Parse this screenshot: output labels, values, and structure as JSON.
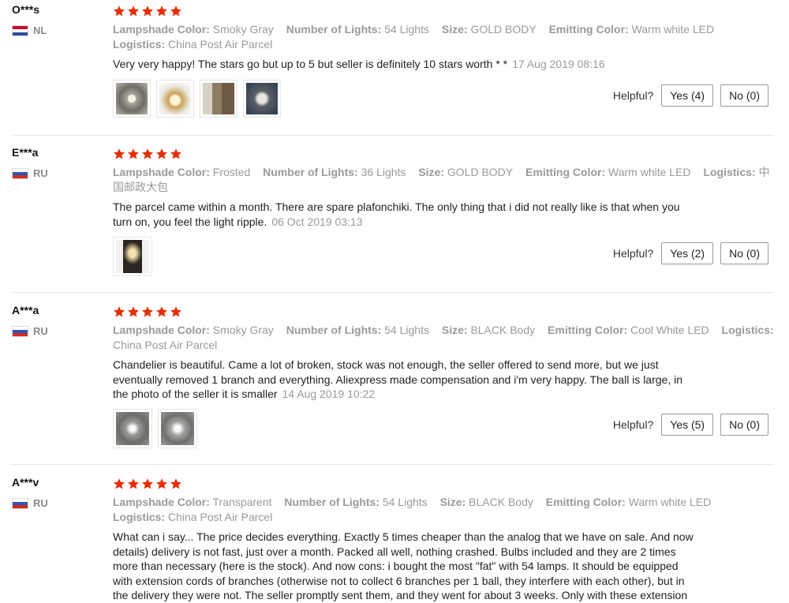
{
  "colors": {
    "star": "#e62e04",
    "meta_text": "#9a9a9a",
    "divider": "#e8e8e8"
  },
  "helpful_label": "Helpful?",
  "reviews": [
    {
      "user": "O***s",
      "country": "NL",
      "stars": 5,
      "attributes": [
        {
          "key": "Lampshade Color:",
          "value": "Smoky Gray"
        },
        {
          "key": "Number of Lights:",
          "value": "54 Lights"
        },
        {
          "key": "Size:",
          "value": "GOLD BODY"
        },
        {
          "key": "Emitting Color:",
          "value": "Warm white LED"
        },
        {
          "key": "Logistics:",
          "value": "China Post Air Parcel"
        }
      ],
      "text": "Very very happy! The stars go but up to 5 but seller is definitely 10 stars worth * *",
      "date": "17 Aug 2019 08:16",
      "photos": 4,
      "yes_label": "Yes (4)",
      "no_label": "No (0)"
    },
    {
      "user": "E***a",
      "country": "RU",
      "stars": 5,
      "attributes": [
        {
          "key": "Lampshade Color:",
          "value": "Frosted"
        },
        {
          "key": "Number of Lights:",
          "value": "36 Lights"
        },
        {
          "key": "Size:",
          "value": "GOLD BODY"
        },
        {
          "key": "Emitting Color:",
          "value": "Warm white LED"
        },
        {
          "key": "Logistics:",
          "value": "中国邮政大包"
        }
      ],
      "text": "The parcel came within a month. There are spare plafonchiki. The only thing that i did not really like is that when you turn on, you feel the light ripple.",
      "date": "06 Oct 2019 03:13",
      "photos": 1,
      "yes_label": "Yes (2)",
      "no_label": "No (0)"
    },
    {
      "user": "A***a",
      "country": "RU",
      "stars": 5,
      "attributes": [
        {
          "key": "Lampshade Color:",
          "value": "Smoky Gray"
        },
        {
          "key": "Number of Lights:",
          "value": "54 Lights"
        },
        {
          "key": "Size:",
          "value": "BLACK Body"
        },
        {
          "key": "Emitting Color:",
          "value": "Cool White LED"
        },
        {
          "key": "Logistics:",
          "value": "China Post Air Parcel"
        }
      ],
      "text": "Chandelier is beautiful. Came a lot of broken, stock was not enough, the seller offered to send more, but we just eventually removed 1 branch and everything. Aliexpress made compensation and i'm very happy. The ball is large, in the photo of the seller it is smaller",
      "date": "14 Aug 2019 10:22",
      "photos": 2,
      "yes_label": "Yes (5)",
      "no_label": "No (0)"
    },
    {
      "user": "A***v",
      "country": "RU",
      "stars": 5,
      "attributes": [
        {
          "key": "Lampshade Color:",
          "value": "Transparent"
        },
        {
          "key": "Number of Lights:",
          "value": "54 Lights"
        },
        {
          "key": "Size:",
          "value": "BLACK Body"
        },
        {
          "key": "Emitting Color:",
          "value": "Warm white LED"
        },
        {
          "key": "Logistics:",
          "value": "China Post Air Parcel"
        }
      ],
      "text": "What can i say... The price decides everything. Exactly 5 times cheaper than the analog that we have on sale. And now details) delivery is not fast, just over a month. Packed all well, nothing crashed. Bulbs included and they are 2 times more than necessary (here is the stock). And now cons: i bought the most \"fat\" with 54 lamps. It should be equipped with extension cords of branches (otherwise not to collect 6 branches per 1 ball, they interfere with each other), but in the delivery they were not. The seller promptly sent them, and they went for about 3 weeks. Only with these extension",
      "date": "",
      "photos": 0,
      "yes_label": "",
      "no_label": ""
    }
  ]
}
